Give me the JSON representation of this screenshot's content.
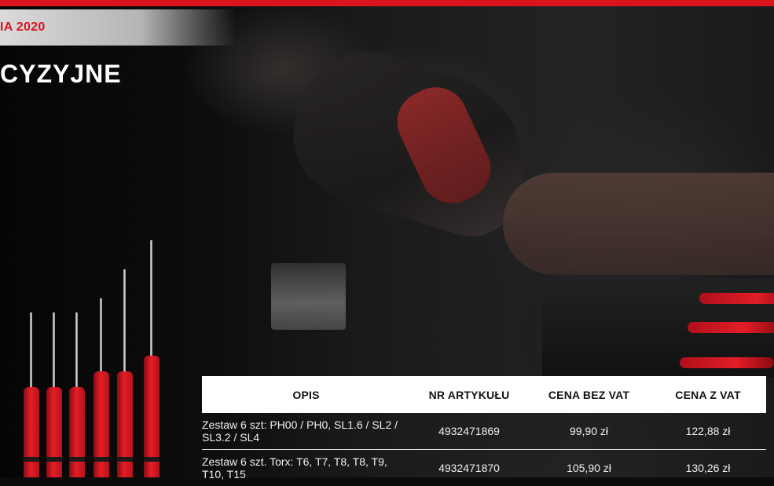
{
  "header": {
    "section_label": "IA 2020",
    "title": "CYZYJNE"
  },
  "table": {
    "columns": [
      "OPIS",
      "NR ARTYKUŁU",
      "CENA BEZ VAT",
      "CENA Z VAT"
    ],
    "rows": [
      {
        "description": "Zestaw 6 szt: PH00 / PH0, SL1.6 / SL2 / SL3.2 / SL4",
        "article_number": "4932471869",
        "price_net": "99,90 zł",
        "price_gross": "122,88 zł"
      },
      {
        "description": "Zestaw 6 szt. Torx: T6, T7, T8, T8, T9, T10, T15",
        "article_number": "4932471870",
        "price_net": "105,90 zł",
        "price_gross": "130,26 zł"
      }
    ]
  },
  "colors": {
    "brand_red": "#d8141f",
    "table_header_bg": "#ffffff"
  }
}
